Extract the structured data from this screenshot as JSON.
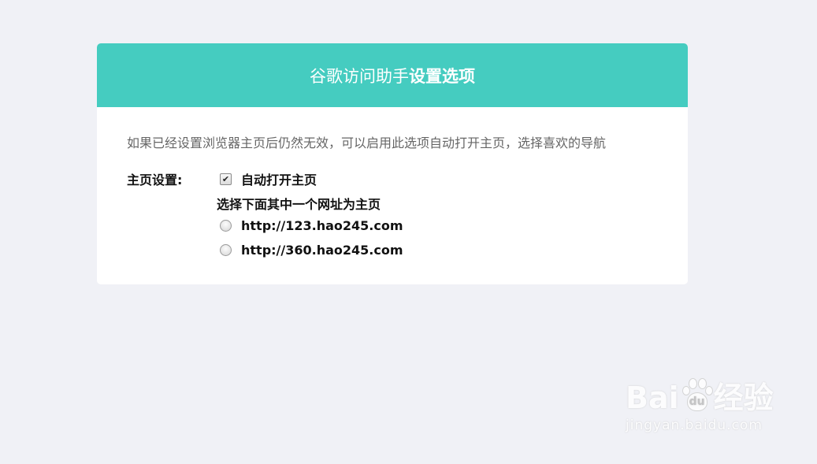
{
  "header": {
    "title_normal": "谷歌访问助手",
    "title_bold": "设置选项"
  },
  "description": "如果已经设置浏览器主页后仍然无效，可以启用此选项自动打开主页，选择喜欢的导航",
  "homepage": {
    "label": "主页设置:",
    "auto_open_label": "自动打开主页",
    "auto_open_checked": true,
    "hint": "选择下面其中一个网址为主页",
    "options": [
      {
        "url": "http://123.hao245.com",
        "selected": false
      },
      {
        "url": "http://360.hao245.com",
        "selected": false
      }
    ]
  },
  "watermark": {
    "brand_left": "Bai",
    "brand_paw": "du",
    "brand_right": "经验",
    "url": "jingyan.baidu.com"
  },
  "colors": {
    "header_bg": "#45ccc0",
    "page_bg": "#f0f1f6"
  }
}
